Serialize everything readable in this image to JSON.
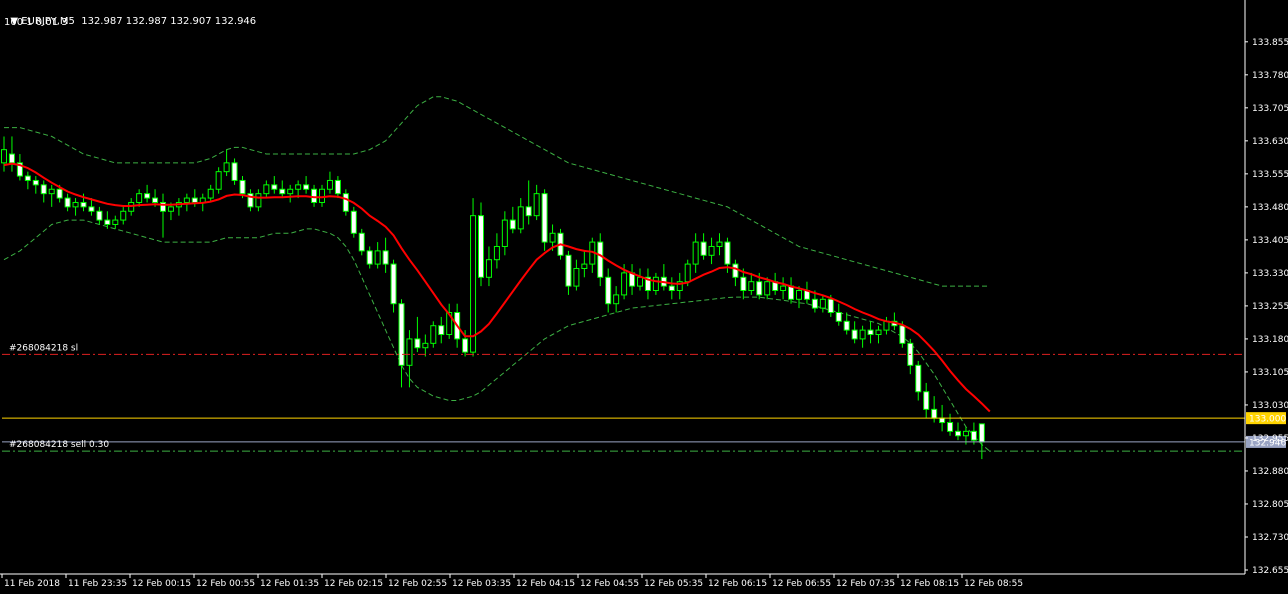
{
  "header": {
    "symbol_line": "EURJPY,M5  132.987 132.987 132.907 132.946",
    "indicator_line": "100 1 0.01 3"
  },
  "orders": [
    {
      "label": "#268084218 sl",
      "price": 133.145,
      "color": "#e02020",
      "style": "dashdot"
    },
    {
      "label": "#268084218 sell 0.30",
      "price": 132.925,
      "color": "#3cb043",
      "style": "dashdot"
    }
  ],
  "price_lines": [
    {
      "label": "133.000",
      "price": 133.0,
      "color": "#ffd400",
      "text_color": "#000000"
    },
    {
      "label": "132.946",
      "price": 132.946,
      "color": "#9aa4c4",
      "text_color": "#000000"
    }
  ],
  "colors": {
    "background": "#000000",
    "candle": "#00ff00",
    "candle_bull_fill": "#000000",
    "candle_bear_fill": "#ffffff",
    "ma": "#ff0000",
    "bands": "#3cb043",
    "axis": "#ffffff"
  },
  "chart_data": {
    "type": "candlestick",
    "symbol": "EURJPY",
    "timeframe": "M5",
    "ylim": [
      132.655,
      133.9
    ],
    "y_ticks": [
      "133.855",
      "133.780",
      "133.705",
      "133.630",
      "133.555",
      "133.480",
      "133.405",
      "133.330",
      "133.255",
      "133.180",
      "133.105",
      "133.030",
      "132.955",
      "132.880",
      "132.805",
      "132.730",
      "132.655"
    ],
    "x_ticks": [
      "11 Feb 2018",
      "11 Feb 23:35",
      "12 Feb 00:15",
      "12 Feb 00:55",
      "12 Feb 01:35",
      "12 Feb 02:15",
      "12 Feb 02:55",
      "12 Feb 03:35",
      "12 Feb 04:15",
      "12 Feb 04:55",
      "12 Feb 05:35",
      "12 Feb 06:15",
      "12 Feb 06:55",
      "12 Feb 07:35",
      "12 Feb 08:15",
      "12 Feb 08:55"
    ],
    "ohlc": [
      [
        133.58,
        133.64,
        133.56,
        133.61
      ],
      [
        133.6,
        133.64,
        133.56,
        133.58
      ],
      [
        133.58,
        133.6,
        133.54,
        133.55
      ],
      [
        133.55,
        133.56,
        133.52,
        133.54
      ],
      [
        133.54,
        133.55,
        133.51,
        133.53
      ],
      [
        133.53,
        133.54,
        133.49,
        133.51
      ],
      [
        133.51,
        133.53,
        133.48,
        133.52
      ],
      [
        133.52,
        133.53,
        133.49,
        133.5
      ],
      [
        133.5,
        133.51,
        133.47,
        133.48
      ],
      [
        133.48,
        133.5,
        133.46,
        133.49
      ],
      [
        133.49,
        133.51,
        133.47,
        133.48
      ],
      [
        133.48,
        133.5,
        133.46,
        133.47
      ],
      [
        133.47,
        133.48,
        133.44,
        133.45
      ],
      [
        133.45,
        133.47,
        133.43,
        133.44
      ],
      [
        133.44,
        133.46,
        133.43,
        133.45
      ],
      [
        133.45,
        133.48,
        133.44,
        133.47
      ],
      [
        133.47,
        133.5,
        133.46,
        133.49
      ],
      [
        133.49,
        133.52,
        133.48,
        133.51
      ],
      [
        133.51,
        133.53,
        133.49,
        133.5
      ],
      [
        133.5,
        133.52,
        133.48,
        133.49
      ],
      [
        133.49,
        133.51,
        133.41,
        133.47
      ],
      [
        133.47,
        133.49,
        133.45,
        133.48
      ],
      [
        133.48,
        133.5,
        133.46,
        133.49
      ],
      [
        133.49,
        133.51,
        133.47,
        133.5
      ],
      [
        133.5,
        133.52,
        133.48,
        133.49
      ],
      [
        133.49,
        133.51,
        133.47,
        133.5
      ],
      [
        133.5,
        133.53,
        133.49,
        133.52
      ],
      [
        133.52,
        133.57,
        133.51,
        133.56
      ],
      [
        133.56,
        133.61,
        133.55,
        133.58
      ],
      [
        133.58,
        133.59,
        133.53,
        133.54
      ],
      [
        133.54,
        133.55,
        133.5,
        133.51
      ],
      [
        133.51,
        133.52,
        133.47,
        133.48
      ],
      [
        133.48,
        133.52,
        133.47,
        133.51
      ],
      [
        133.51,
        133.54,
        133.5,
        133.53
      ],
      [
        133.53,
        133.55,
        133.51,
        133.52
      ],
      [
        133.52,
        133.54,
        133.5,
        133.51
      ],
      [
        133.51,
        133.53,
        133.49,
        133.52
      ],
      [
        133.52,
        133.54,
        133.5,
        133.53
      ],
      [
        133.53,
        133.55,
        133.51,
        133.52
      ],
      [
        133.52,
        133.53,
        133.48,
        133.49
      ],
      [
        133.49,
        133.53,
        133.48,
        133.52
      ],
      [
        133.52,
        133.56,
        133.51,
        133.54
      ],
      [
        133.54,
        133.55,
        133.5,
        133.51
      ],
      [
        133.51,
        133.52,
        133.46,
        133.47
      ],
      [
        133.47,
        133.48,
        133.41,
        133.42
      ],
      [
        133.42,
        133.43,
        133.37,
        133.38
      ],
      [
        133.38,
        133.39,
        133.34,
        133.35
      ],
      [
        133.35,
        133.4,
        133.34,
        133.38
      ],
      [
        133.38,
        133.41,
        133.33,
        133.35
      ],
      [
        133.35,
        133.36,
        133.24,
        133.26
      ],
      [
        133.26,
        133.27,
        133.07,
        133.12
      ],
      [
        133.12,
        133.2,
        133.07,
        133.18
      ],
      [
        133.18,
        133.23,
        133.15,
        133.16
      ],
      [
        133.16,
        133.19,
        133.14,
        133.17
      ],
      [
        133.17,
        133.22,
        133.16,
        133.21
      ],
      [
        133.21,
        133.23,
        133.17,
        133.19
      ],
      [
        133.19,
        133.26,
        133.18,
        133.24
      ],
      [
        133.24,
        133.26,
        133.16,
        133.18
      ],
      [
        133.18,
        133.2,
        133.14,
        133.15
      ],
      [
        133.15,
        133.5,
        133.14,
        133.46
      ],
      [
        133.46,
        133.49,
        133.3,
        133.32
      ],
      [
        133.32,
        133.39,
        133.3,
        133.36
      ],
      [
        133.36,
        133.42,
        133.34,
        133.39
      ],
      [
        133.39,
        133.47,
        133.37,
        133.45
      ],
      [
        133.45,
        133.48,
        133.42,
        133.43
      ],
      [
        133.43,
        133.5,
        133.42,
        133.48
      ],
      [
        133.48,
        133.54,
        133.44,
        133.46
      ],
      [
        133.46,
        133.53,
        133.45,
        133.51
      ],
      [
        133.51,
        133.52,
        133.38,
        133.4
      ],
      [
        133.4,
        133.44,
        133.38,
        133.42
      ],
      [
        133.42,
        133.43,
        133.36,
        133.37
      ],
      [
        133.37,
        133.38,
        133.28,
        133.3
      ],
      [
        133.3,
        133.36,
        133.29,
        133.34
      ],
      [
        133.34,
        133.38,
        133.32,
        133.35
      ],
      [
        133.35,
        133.41,
        133.33,
        133.4
      ],
      [
        133.4,
        133.42,
        133.3,
        133.32
      ],
      [
        133.32,
        133.34,
        133.24,
        133.26
      ],
      [
        133.26,
        133.3,
        133.24,
        133.28
      ],
      [
        133.28,
        133.35,
        133.27,
        133.33
      ],
      [
        133.33,
        133.35,
        133.28,
        133.3
      ],
      [
        133.3,
        133.34,
        133.29,
        133.32
      ],
      [
        133.32,
        133.34,
        133.27,
        133.29
      ],
      [
        133.29,
        133.33,
        133.28,
        133.32
      ],
      [
        133.32,
        133.35,
        133.29,
        133.3
      ],
      [
        133.3,
        133.32,
        133.27,
        133.29
      ],
      [
        133.29,
        133.33,
        133.27,
        133.31
      ],
      [
        133.31,
        133.36,
        133.3,
        133.35
      ],
      [
        133.35,
        133.42,
        133.33,
        133.4
      ],
      [
        133.4,
        133.42,
        133.36,
        133.37
      ],
      [
        133.37,
        133.41,
        133.35,
        133.39
      ],
      [
        133.39,
        133.42,
        133.37,
        133.4
      ],
      [
        133.4,
        133.41,
        133.33,
        133.35
      ],
      [
        133.35,
        133.36,
        133.3,
        133.32
      ],
      [
        133.32,
        133.34,
        133.27,
        133.29
      ],
      [
        133.29,
        133.33,
        133.28,
        133.31
      ],
      [
        133.31,
        133.33,
        133.27,
        133.28
      ],
      [
        133.28,
        133.32,
        133.27,
        133.31
      ],
      [
        133.31,
        133.33,
        133.28,
        133.29
      ],
      [
        133.29,
        133.32,
        133.27,
        133.3
      ],
      [
        133.3,
        133.32,
        133.26,
        133.27
      ],
      [
        133.27,
        133.3,
        133.25,
        133.29
      ],
      [
        133.29,
        133.31,
        133.26,
        133.27
      ],
      [
        133.27,
        133.29,
        133.24,
        133.25
      ],
      [
        133.25,
        133.28,
        133.24,
        133.27
      ],
      [
        133.27,
        133.28,
        133.23,
        133.24
      ],
      [
        133.24,
        133.26,
        133.21,
        133.22
      ],
      [
        133.22,
        133.24,
        133.19,
        133.2
      ],
      [
        133.2,
        133.22,
        133.17,
        133.18
      ],
      [
        133.18,
        133.21,
        133.16,
        133.2
      ],
      [
        133.2,
        133.22,
        133.17,
        133.19
      ],
      [
        133.19,
        133.21,
        133.17,
        133.2
      ],
      [
        133.2,
        133.23,
        133.19,
        133.22
      ],
      [
        133.22,
        133.24,
        133.2,
        133.21
      ],
      [
        133.21,
        133.22,
        133.16,
        133.17
      ],
      [
        133.17,
        133.18,
        133.1,
        133.12
      ],
      [
        133.12,
        133.13,
        133.04,
        133.06
      ],
      [
        133.06,
        133.08,
        133.0,
        133.02
      ],
      [
        133.02,
        133.05,
        132.99,
        133.0
      ],
      [
        133.0,
        133.03,
        132.97,
        132.99
      ],
      [
        132.99,
        133.01,
        132.96,
        132.97
      ],
      [
        132.97,
        132.99,
        132.95,
        132.96
      ],
      [
        132.96,
        132.98,
        132.94,
        132.97
      ],
      [
        132.97,
        132.99,
        132.94,
        132.95
      ],
      [
        132.987,
        132.987,
        132.907,
        132.946
      ]
    ],
    "ma": [
      133.575,
      133.578,
      133.575,
      133.568,
      133.558,
      133.546,
      133.535,
      133.525,
      133.515,
      133.508,
      133.502,
      133.497,
      133.492,
      133.487,
      133.484,
      133.482,
      133.482,
      133.484,
      133.485,
      133.486,
      133.485,
      133.485,
      133.486,
      133.487,
      133.488,
      133.489,
      133.492,
      133.497,
      133.505,
      133.508,
      133.507,
      133.503,
      133.501,
      133.501,
      133.502,
      133.502,
      133.503,
      133.504,
      133.504,
      133.502,
      133.502,
      133.504,
      133.503,
      133.498,
      133.489,
      133.476,
      133.46,
      133.448,
      133.435,
      133.415,
      133.386,
      133.36,
      133.336,
      133.31,
      133.284,
      133.258,
      133.236,
      133.21,
      133.186,
      133.186,
      133.197,
      133.214,
      133.238,
      133.263,
      133.288,
      133.313,
      133.337,
      133.36,
      133.375,
      133.388,
      133.395,
      133.39,
      133.384,
      133.38,
      133.378,
      133.37,
      133.358,
      133.347,
      133.337,
      133.329,
      133.322,
      133.315,
      133.311,
      133.309,
      133.306,
      133.305,
      133.308,
      133.317,
      133.326,
      133.333,
      133.341,
      133.343,
      133.34,
      133.332,
      133.327,
      133.32,
      133.315,
      133.309,
      133.305,
      133.299,
      133.295,
      133.29,
      133.284,
      133.279,
      133.273,
      133.265,
      133.257,
      133.248,
      133.24,
      133.233,
      133.225,
      133.22,
      133.217,
      133.212,
      133.203,
      133.19,
      133.172,
      133.153,
      133.131,
      133.107,
      133.086,
      133.066,
      133.05,
      133.033,
      133.015
    ],
    "bands_upper": [
      133.66,
      133.66,
      133.66,
      133.655,
      133.65,
      133.645,
      133.64,
      133.63,
      133.62,
      133.61,
      133.6,
      133.595,
      133.59,
      133.585,
      133.58,
      133.58,
      133.58,
      133.58,
      133.58,
      133.58,
      133.58,
      133.58,
      133.58,
      133.58,
      133.58,
      133.585,
      133.59,
      133.6,
      133.61,
      133.615,
      133.615,
      133.61,
      133.605,
      133.6,
      133.6,
      133.6,
      133.6,
      133.6,
      133.6,
      133.6,
      133.6,
      133.6,
      133.6,
      133.6,
      133.6,
      133.605,
      133.61,
      133.62,
      133.63,
      133.65,
      133.67,
      133.69,
      133.71,
      133.72,
      133.73,
      133.73,
      133.725,
      133.72,
      133.71,
      133.7,
      133.69,
      133.68,
      133.67,
      133.66,
      133.65,
      133.64,
      133.63,
      133.62,
      133.61,
      133.6,
      133.59,
      133.58,
      133.575,
      133.57,
      133.565,
      133.56,
      133.555,
      133.55,
      133.545,
      133.54,
      133.535,
      133.53,
      133.525,
      133.52,
      133.515,
      133.51,
      133.505,
      133.5,
      133.495,
      133.49,
      133.485,
      133.48,
      133.47,
      133.46,
      133.45,
      133.44,
      133.43,
      133.42,
      133.41,
      133.4,
      133.39,
      133.385,
      133.38,
      133.375,
      133.37,
      133.365,
      133.36,
      133.355,
      133.35,
      133.345,
      133.34,
      133.335,
      133.33,
      133.325,
      133.32,
      133.315,
      133.31,
      133.305,
      133.3,
      133.3,
      133.3,
      133.3,
      133.3,
      133.3,
      133.3
    ],
    "bands_lower": [
      133.36,
      133.37,
      133.38,
      133.395,
      133.41,
      133.425,
      133.44,
      133.445,
      133.45,
      133.45,
      133.45,
      133.445,
      133.44,
      133.435,
      133.43,
      133.425,
      133.42,
      133.415,
      133.41,
      133.405,
      133.4,
      133.4,
      133.4,
      133.4,
      133.4,
      133.4,
      133.4,
      133.405,
      133.41,
      133.41,
      133.41,
      133.41,
      133.41,
      133.415,
      133.42,
      133.42,
      133.42,
      133.425,
      133.43,
      133.43,
      133.425,
      133.42,
      133.41,
      133.39,
      133.36,
      133.32,
      133.28,
      133.24,
      133.2,
      133.16,
      133.12,
      133.09,
      133.07,
      133.06,
      133.05,
      133.045,
      133.04,
      133.04,
      133.045,
      133.05,
      133.06,
      133.075,
      133.09,
      133.105,
      133.12,
      133.135,
      133.15,
      133.165,
      133.18,
      133.19,
      133.2,
      133.21,
      133.215,
      133.22,
      133.225,
      133.23,
      133.235,
      133.24,
      133.245,
      133.25,
      133.252,
      133.254,
      133.256,
      133.258,
      133.26,
      133.262,
      133.264,
      133.266,
      133.268,
      133.27,
      133.272,
      133.274,
      133.275,
      133.275,
      133.275,
      133.275,
      133.272,
      133.27,
      133.268,
      133.265,
      133.262,
      133.26,
      133.255,
      133.25,
      133.245,
      133.24,
      133.235,
      133.23,
      133.225,
      133.22,
      133.215,
      133.205,
      133.195,
      133.185,
      133.17,
      133.15,
      133.125,
      133.1,
      133.07,
      133.04,
      133.01,
      132.98,
      132.96,
      132.94,
      132.925
    ]
  }
}
